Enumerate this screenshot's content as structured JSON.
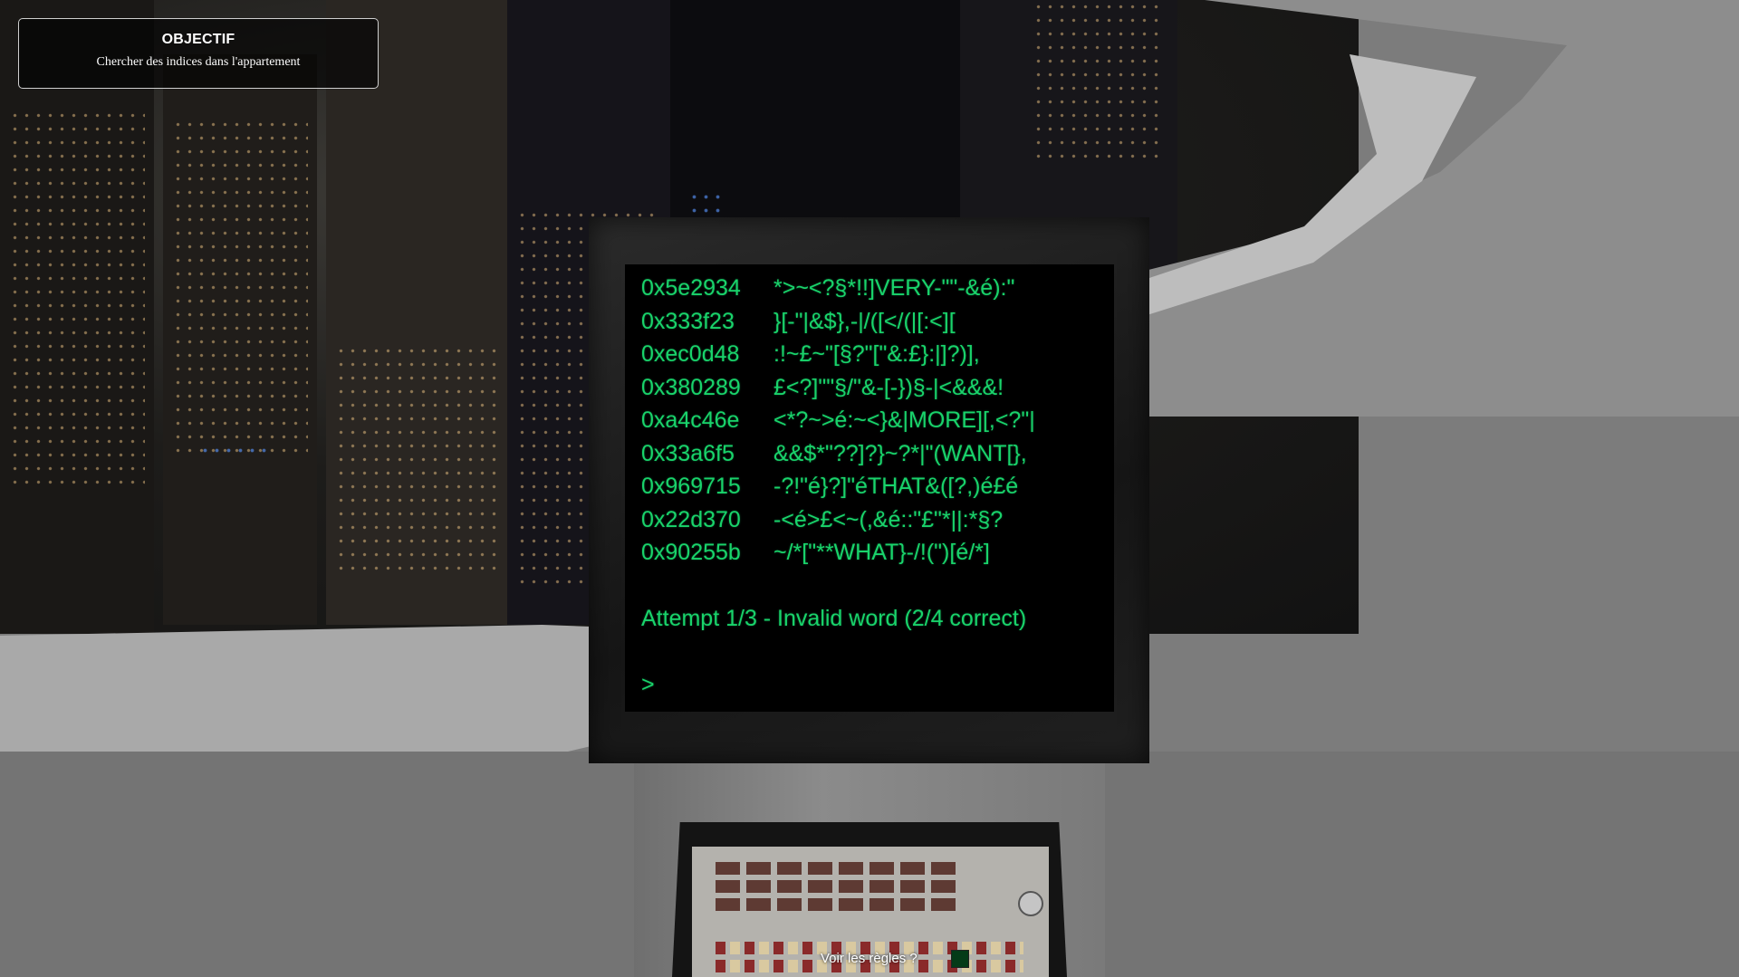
{
  "objective": {
    "title": "OBJECTIF",
    "text": "Chercher des indices dans l'appartement"
  },
  "terminal": {
    "text_color": "#19d36b",
    "lines": [
      {
        "addr": "0x5e2934",
        "data": "*>~<?§*!!]VERY-\"\"-&é):\""
      },
      {
        "addr": "0x333f23",
        "data": "}[-\"|&$},-|/([</(|[:<]["
      },
      {
        "addr": "0xec0d48",
        "data": ":!~£~\"[§?\"[\"&:£}:|]?)],"
      },
      {
        "addr": "0x380289",
        "data": "£<?]\"\"§/\"&-[-})§-|<&&&!"
      },
      {
        "addr": "0xa4c46e",
        "data": "<*?~>é:~<}&|MORE][,<?\"|"
      },
      {
        "addr": "0x33a6f5",
        "data": "&&$*\"??]?}~?*|\"(WANT[},"
      },
      {
        "addr": "0x969715",
        "data": "-?!\"é}?]\"éTHAT&([?,)é£é"
      },
      {
        "addr": "0x22d370",
        "data": "-<é>£<~(,&é::\"£\"*||:*§?"
      },
      {
        "addr": "0x90255b",
        "data": "~/*[\"**WHAT}-/!(\")[é/*]"
      }
    ],
    "status": "Attempt 1/3 - Invalid word (2/4 correct)",
    "prompt": ">"
  },
  "footer": {
    "rules_link": "Voir les règles ?"
  }
}
